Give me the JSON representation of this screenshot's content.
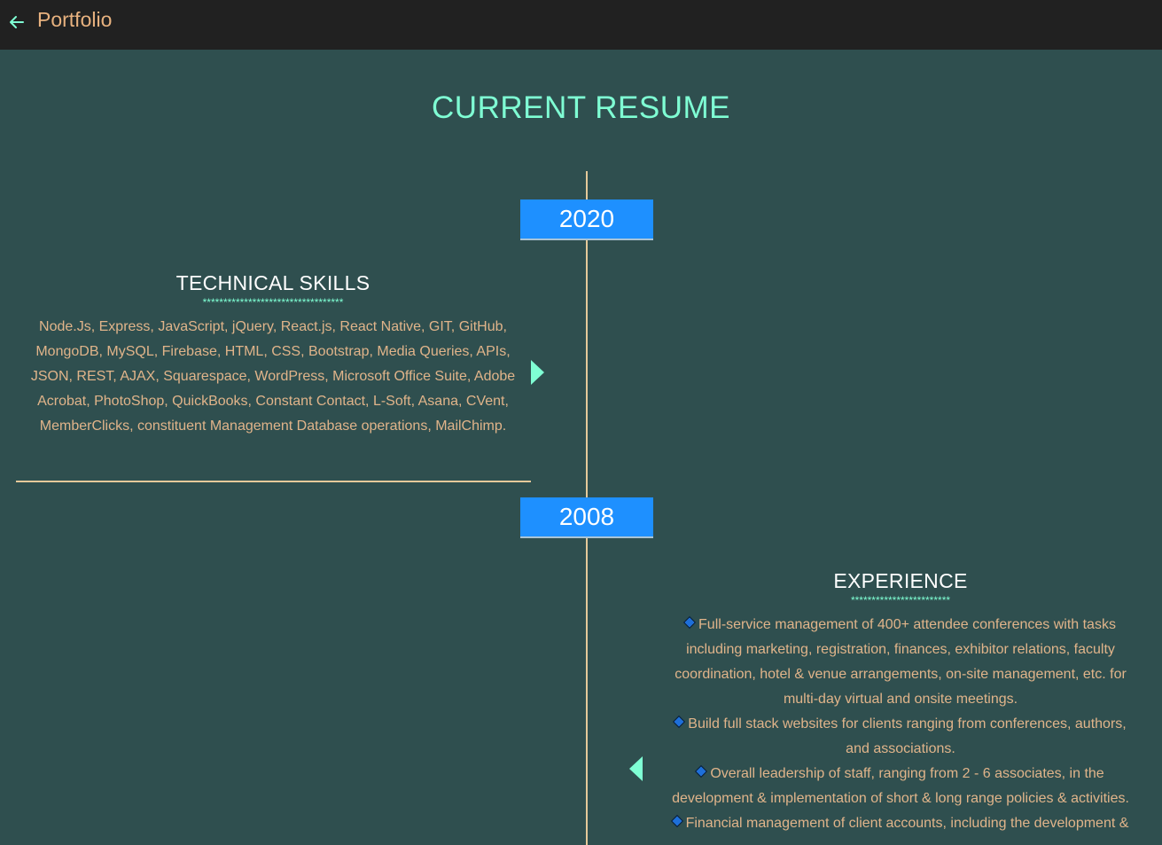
{
  "header": {
    "brand": "Portfolio",
    "back_icon": "arrow-left-icon"
  },
  "page": {
    "title": "CURRENT RESUME"
  },
  "timeline": [
    {
      "year": "2020",
      "section_title": "TECHNICAL SKILLS",
      "stars": "**********************************",
      "body": "Node.Js, Express, JavaScript, jQuery, React.js, React Native, GIT, GitHub, MongoDB, MySQL, Firebase, HTML, CSS, Bootstrap, Media Queries, APIs, JSON, REST, AJAX, Squarespace, WordPress, Microsoft Office Suite, Adobe Acrobat, PhotoShop, QuickBooks, Constant Contact, L-Soft, Asana, CVent, MemberClicks, constituent Management Database operations, MailChimp."
    },
    {
      "year": "2008",
      "section_title": "EXPERIENCE",
      "stars": "************************",
      "bullets": [
        "Full-service management of 400+ attendee conferences with tasks including marketing, registration, finances, exhibitor relations, faculty coordination, hotel & venue arrangements, on-site management, etc. for multi-day virtual and onsite meetings.",
        "Build full stack websites for clients ranging from conferences, authors, and associations.",
        "Overall leadership of staff, ranging from 2 - 6 associates, in the development & implementation of short & long range policies & activities.",
        "Financial management of client accounts, including the development &"
      ]
    }
  ],
  "colors": {
    "background": "#2f4f4f",
    "topbar": "#212121",
    "accent": "#7fffd4",
    "brand": "#e8b27f",
    "year_badge": "#1e90ff",
    "body_text": "#e0b48a",
    "timeline_line": "#e5c99a"
  }
}
